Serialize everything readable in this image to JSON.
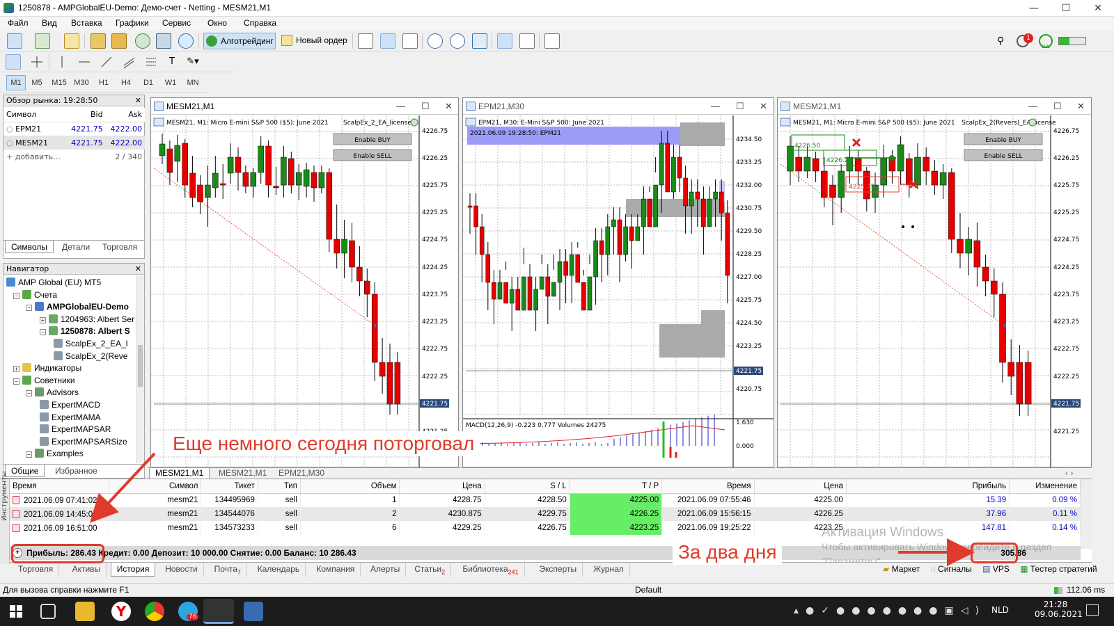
{
  "window": {
    "title": "1250878 - AMPGlobalEU-Demo: Демо-счет - Netting - MESM21,M1",
    "controls": {
      "minimize": "—",
      "maximize": "☐",
      "close": "✕"
    }
  },
  "menu": [
    "Файл",
    "Вид",
    "Вставка",
    "Графики",
    "Сервис",
    "Окно",
    "Справка"
  ],
  "toolbar": {
    "algo_label": "Алготрейдинг",
    "new_order_label": "Новый ордер",
    "notif_count": "1",
    "lvl_label": "LVL"
  },
  "timeframes": [
    "M1",
    "M5",
    "M15",
    "M30",
    "H1",
    "H4",
    "D1",
    "W1",
    "MN"
  ],
  "active_timeframe": "M1",
  "market_watch": {
    "header": "Обзор рынка: 19:28:50",
    "columns": [
      "Символ",
      "Bid",
      "Ask"
    ],
    "rows": [
      {
        "symbol": "EPM21",
        "bid": "4221.75",
        "ask": "4222.00"
      },
      {
        "symbol": "MESM21",
        "bid": "4221.75",
        "ask": "4222.00"
      }
    ],
    "add_label": "добавить...",
    "count": "2 / 340",
    "tabs": [
      "Символы",
      "Детали",
      "Торговля"
    ]
  },
  "navigator": {
    "header": "Навигатор",
    "items": [
      {
        "label": "AMP Global (EU) MT5",
        "icon": "broker-icon",
        "bold": false
      },
      {
        "label": "Счета",
        "icon": "accounts-icon",
        "bold": false
      },
      {
        "label": "AMPGlobalEU-Demo",
        "icon": "server-icon",
        "bold": true
      },
      {
        "label": "1204963: Albert Ser",
        "icon": "account-icon",
        "bold": false
      },
      {
        "label": "1250878: Albert S",
        "icon": "account-icon",
        "bold": true
      },
      {
        "label": "ScalpEx_2_EA_l",
        "icon": "expert-icon",
        "bold": false
      },
      {
        "label": "ScalpEx_2(Reve",
        "icon": "expert-icon",
        "bold": false
      },
      {
        "label": "Индикаторы",
        "icon": "indicator-icon",
        "bold": false
      },
      {
        "label": "Советники",
        "icon": "advisors-icon",
        "bold": false
      },
      {
        "label": "Advisors",
        "icon": "folder-icon",
        "bold": false
      },
      {
        "label": "ExpertMACD",
        "icon": "expert-icon",
        "bold": false
      },
      {
        "label": "ExpertMAMA",
        "icon": "expert-icon",
        "bold": false
      },
      {
        "label": "ExpertMAPSAR",
        "icon": "expert-icon",
        "bold": false
      },
      {
        "label": "ExpertMAPSARSize",
        "icon": "expert-icon",
        "bold": false
      },
      {
        "label": "Examples",
        "icon": "folder-icon",
        "bold": false
      }
    ],
    "tabs": [
      "Общие",
      "Избранное"
    ]
  },
  "charts": [
    {
      "window_title": "MESM21,M1",
      "info": "MESM21, M1:  Micro E-mini S&P 500 ($5): June 2021",
      "ea": "ScalpEx_2_EA_license",
      "enable_buy": "Enable BUY",
      "enable_sell": "Enable SELL",
      "price_labels": [
        "4226.75",
        "4226.25",
        "4225.75",
        "4225.25",
        "4224.75",
        "4224.25",
        "4223.75",
        "4223.25",
        "4222.75",
        "4222.25",
        "4221.25"
      ],
      "current_price": "4221.75"
    },
    {
      "window_title": "EPM21,M30",
      "info": "EPM21, M30:  E-Mini S&P 500: June 2021",
      "subinfo": "2021.06.09 19:28:50: EPM21",
      "price_labels": [
        "4234.50",
        "4233.25",
        "4232.00",
        "4230.75",
        "4229.50",
        "4228.25",
        "4227.00",
        "4225.75",
        "4224.50",
        "4223.25",
        "4220.75"
      ],
      "current_price": "4221.75",
      "macd_label": "MACD(12,26,9) -0.223 0.777 Volumes 24275",
      "macd_levels": [
        "1.630",
        "0.000"
      ]
    },
    {
      "window_title": "MESM21,M1",
      "info": "MESM21, M1:  Micro E-mini S&P 500 ($5): June 2021",
      "ea": "ScalpEx_2(Revers)_EA_license",
      "enable_buy": "Enable BUY",
      "enable_sell": "Enable SELL",
      "price_labels": [
        "4226.75",
        "4226.25",
        "4225.75",
        "4225.25",
        "4224.75",
        "4224.25",
        "4223.75",
        "4223.25",
        "4222.75",
        "4222.25",
        "4221.25"
      ],
      "current_price": "4221.75",
      "overlay_labels": [
        "4226.50",
        "4226.25",
        "4225.75"
      ]
    }
  ],
  "chart_tabs": [
    "MESM21,M1",
    "MESM21,M1",
    "EPM21,M30"
  ],
  "history": {
    "columns": [
      "Время",
      "Символ",
      "Тикет",
      "Тип",
      "Объем",
      "Цена",
      "S / L",
      "T / P",
      "Время",
      "Цена",
      "Прибыль",
      "Изменение"
    ],
    "rows": [
      [
        "2021.06.09 07:41:02",
        "mesm21",
        "134495969",
        "sell",
        "1",
        "4228.75",
        "4228.50",
        "4225.00",
        "2021.06.09 07:55:46",
        "4225.00",
        "15.39",
        "0.09 %"
      ],
      [
        "2021.06.09 14:45:00",
        "mesm21",
        "134544076",
        "sell",
        "2",
        "4230.875",
        "4229.75",
        "4226.25",
        "2021.06.09 15:56:15",
        "4226.25",
        "37.96",
        "0.11 %"
      ],
      [
        "2021.06.09 16:51:00",
        "mesm21",
        "134573233",
        "sell",
        "6",
        "4229.25",
        "4226.75",
        "4223.25",
        "2021.06.09 19:25:22",
        "4223.25",
        "147.81",
        "0.14 %"
      ]
    ],
    "summary": "Прибыль: 286.43  Кредит: 0.00  Депозит: 10 000.00  Снятие: 0.00  Баланс: 10 286.43",
    "total": "305.86",
    "side_label": "Инструменты"
  },
  "watermark": {
    "line1": "Активация Windows",
    "line2": "Чтобы активировать Windows, перейдите в раздел",
    "line3": "\"Параметры\"."
  },
  "terminal_tabs": [
    {
      "label": "Торговля",
      "badge": ""
    },
    {
      "label": "Активы",
      "badge": ""
    },
    {
      "label": "История",
      "badge": ""
    },
    {
      "label": "Новости",
      "badge": ""
    },
    {
      "label": "Почта",
      "badge": "7"
    },
    {
      "label": "Календарь",
      "badge": ""
    },
    {
      "label": "Компания",
      "badge": ""
    },
    {
      "label": "Алерты",
      "badge": ""
    },
    {
      "label": "Статьи",
      "badge": "2"
    },
    {
      "label": "Библиотека",
      "badge": "241"
    },
    {
      "label": "Эксперты",
      "badge": ""
    },
    {
      "label": "Журнал",
      "badge": ""
    }
  ],
  "active_terminal_tab": "История",
  "right_links": [
    "Маркет",
    "Сигналы",
    "VPS",
    "Тестер стратегий"
  ],
  "status": {
    "help": "Для вызова справки нажмите F1",
    "profile": "Default",
    "ping": "112.06 ms"
  },
  "taskbar": {
    "time": "21:28",
    "date": "09.06.2021",
    "lang": "NLD",
    "badge": "76"
  },
  "annotations": {
    "top": "Еще немного сегодня поторговал",
    "bottom": "За два дня"
  },
  "colors": {
    "accent": "#e03b2a",
    "bull": "#1a8a1a",
    "bear": "#e60000",
    "tp": "#66ee66",
    "profit": "#0000c8"
  }
}
